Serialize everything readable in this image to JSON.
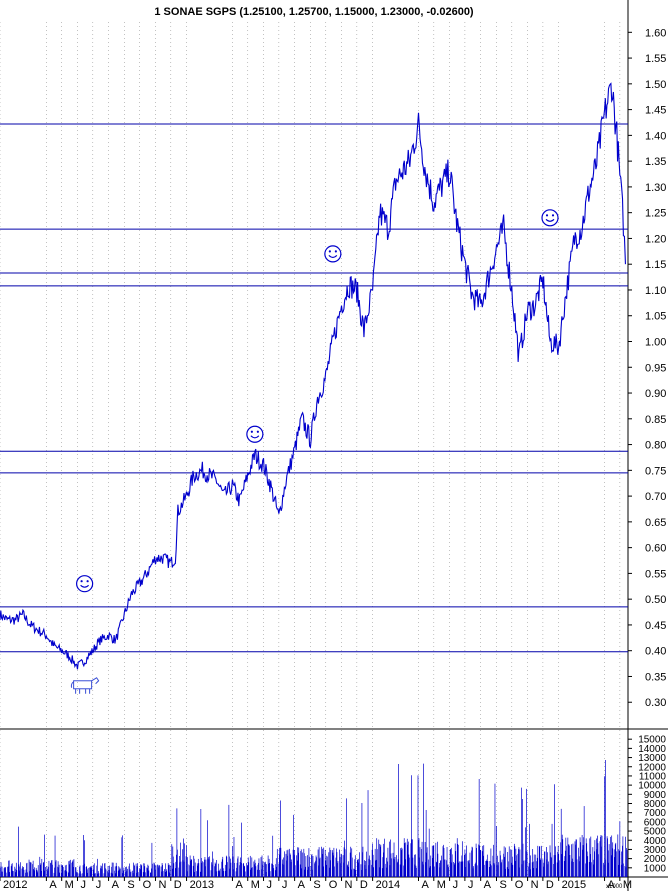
{
  "chart_data": [
    {
      "type": "line",
      "title": "1 SONAE SGPS (1.25100, 1.25700, 1.15000, 1.23000, -0.02600)",
      "ylim": [
        0.25,
        1.62
      ],
      "y_ticks": [
        "1.60",
        "1.55",
        "1.50",
        "1.45",
        "1.40",
        "1.35",
        "1.30",
        "1.25",
        "1.20",
        "1.15",
        "1.10",
        "1.05",
        "1.00",
        "0.95",
        "0.90",
        "0.85",
        "0.80",
        "0.75",
        "0.70",
        "0.65",
        "0.60",
        "0.55",
        "0.50",
        "0.45",
        "0.40",
        "0.35",
        "0.30"
      ],
      "grid": "vertical dotted lines at month boundaries",
      "horizontal_levels": [
        1.422,
        1.218,
        1.133,
        1.108,
        0.787,
        0.745,
        0.485,
        0.398
      ],
      "smiley_markers": [
        {
          "x": "2012-06",
          "y": 0.53
        },
        {
          "x": "2013-05",
          "y": 0.82
        },
        {
          "x": "2013-10",
          "y": 1.17
        },
        {
          "x": "2014-12",
          "y": 1.24
        }
      ],
      "cow_marker": {
        "x": "2012-06",
        "y": 0.33
      },
      "series": [
        {
          "color": "#0000cc",
          "points": [
            [
              "2012-01-01",
              0.47
            ],
            [
              "2012-01-15",
              0.46
            ],
            [
              "2012-02-01",
              0.46
            ],
            [
              "2012-02-15",
              0.47
            ],
            [
              "2012-03-01",
              0.45
            ],
            [
              "2012-03-15",
              0.44
            ],
            [
              "2012-04-01",
              0.43
            ],
            [
              "2012-04-15",
              0.41
            ],
            [
              "2012-05-01",
              0.4
            ],
            [
              "2012-05-15",
              0.39
            ],
            [
              "2012-06-01",
              0.37
            ],
            [
              "2012-06-15",
              0.38
            ],
            [
              "2012-07-01",
              0.4
            ],
            [
              "2012-07-15",
              0.42
            ],
            [
              "2012-08-01",
              0.43
            ],
            [
              "2012-08-15",
              0.42
            ],
            [
              "2012-09-01",
              0.47
            ],
            [
              "2012-09-15",
              0.51
            ],
            [
              "2012-10-01",
              0.53
            ],
            [
              "2012-10-15",
              0.55
            ],
            [
              "2012-11-01",
              0.58
            ],
            [
              "2012-11-15",
              0.58
            ],
            [
              "2012-12-01",
              0.57
            ],
            [
              "2012-12-10",
              0.58
            ],
            [
              "2012-12-15",
              0.67
            ],
            [
              "2013-01-01",
              0.7
            ],
            [
              "2013-01-15",
              0.74
            ],
            [
              "2013-02-01",
              0.75
            ],
            [
              "2013-02-15",
              0.74
            ],
            [
              "2013-03-01",
              0.73
            ],
            [
              "2013-03-15",
              0.7
            ],
            [
              "2013-04-01",
              0.72
            ],
            [
              "2013-04-15",
              0.69
            ],
            [
              "2013-05-01",
              0.74
            ],
            [
              "2013-05-15",
              0.78
            ],
            [
              "2013-06-01",
              0.76
            ],
            [
              "2013-06-15",
              0.72
            ],
            [
              "2013-07-01",
              0.66
            ],
            [
              "2013-07-15",
              0.73
            ],
            [
              "2013-08-01",
              0.79
            ],
            [
              "2013-08-15",
              0.85
            ],
            [
              "2013-09-01",
              0.81
            ],
            [
              "2013-09-15",
              0.89
            ],
            [
              "2013-10-01",
              0.93
            ],
            [
              "2013-10-15",
              1.0
            ],
            [
              "2013-11-01",
              1.07
            ],
            [
              "2013-11-15",
              1.11
            ],
            [
              "2013-12-01",
              1.1
            ],
            [
              "2013-12-15",
              1.02
            ],
            [
              "2014-01-01",
              1.1
            ],
            [
              "2014-01-15",
              1.25
            ],
            [
              "2014-02-01",
              1.22
            ],
            [
              "2014-02-15",
              1.31
            ],
            [
              "2014-03-01",
              1.33
            ],
            [
              "2014-03-15",
              1.35
            ],
            [
              "2014-04-01",
              1.42
            ],
            [
              "2014-04-15",
              1.33
            ],
            [
              "2014-05-01",
              1.27
            ],
            [
              "2014-05-15",
              1.3
            ],
            [
              "2014-06-01",
              1.33
            ],
            [
              "2014-06-15",
              1.23
            ],
            [
              "2014-07-01",
              1.15
            ],
            [
              "2014-07-15",
              1.09
            ],
            [
              "2014-08-01",
              1.07
            ],
            [
              "2014-08-15",
              1.12
            ],
            [
              "2014-09-01",
              1.18
            ],
            [
              "2014-09-15",
              1.22
            ],
            [
              "2014-10-01",
              1.1
            ],
            [
              "2014-10-15",
              0.97
            ],
            [
              "2014-11-01",
              1.06
            ],
            [
              "2014-11-15",
              1.07
            ],
            [
              "2014-12-01",
              1.12
            ],
            [
              "2014-12-15",
              1.0
            ],
            [
              "2015-01-01",
              0.99
            ],
            [
              "2015-01-15",
              1.09
            ],
            [
              "2015-02-01",
              1.2
            ],
            [
              "2015-02-15",
              1.22
            ],
            [
              "2015-03-01",
              1.29
            ],
            [
              "2015-03-15",
              1.34
            ],
            [
              "2015-04-01",
              1.44
            ],
            [
              "2015-04-15",
              1.5
            ],
            [
              "2015-04-25",
              1.4
            ],
            [
              "2015-05-01",
              1.32
            ],
            [
              "2015-05-08",
              1.23
            ],
            [
              "2015-05-12",
              1.15
            ]
          ]
        }
      ]
    },
    {
      "type": "bar",
      "y_ticks": [
        "15000",
        "14000",
        "13000",
        "12000",
        "11000",
        "10000",
        "9000",
        "8000",
        "7000",
        "6000",
        "5000",
        "4000",
        "3000",
        "2000",
        "1000"
      ],
      "ylim": [
        0,
        16000
      ],
      "x_ticks": [
        "2012",
        "A",
        "M",
        "J",
        "J",
        "A",
        "S",
        "O",
        "N",
        "D",
        "2013",
        "A",
        "M",
        "J",
        "J",
        "A",
        "S",
        "O",
        "N",
        "D",
        "2014",
        "A",
        "M",
        "J",
        "J",
        "A",
        "S",
        "O",
        "N",
        "D",
        "2015",
        "A",
        "M"
      ],
      "scale_note": "x1000",
      "volume_envelope": [
        {
          "period": "2012-01/2012-05",
          "typical": 1500,
          "peak": 6000
        },
        {
          "period": "2012-06/2012-11",
          "typical": 1200,
          "peak": 5000
        },
        {
          "period": "2012-12",
          "typical": 3000,
          "peak": 10500
        },
        {
          "period": "2013-01/2013-06",
          "typical": 1800,
          "peak": 8000
        },
        {
          "period": "2013-07/2013-12",
          "typical": 2500,
          "peak": 9500
        },
        {
          "period": "2014-01/2014-06",
          "typical": 3200,
          "peak": 12500
        },
        {
          "period": "2014-07/2014-12",
          "typical": 2800,
          "peak": 11000
        },
        {
          "period": "2015-01/2015-05",
          "typical": 3500,
          "peak": 14000
        }
      ]
    }
  ]
}
